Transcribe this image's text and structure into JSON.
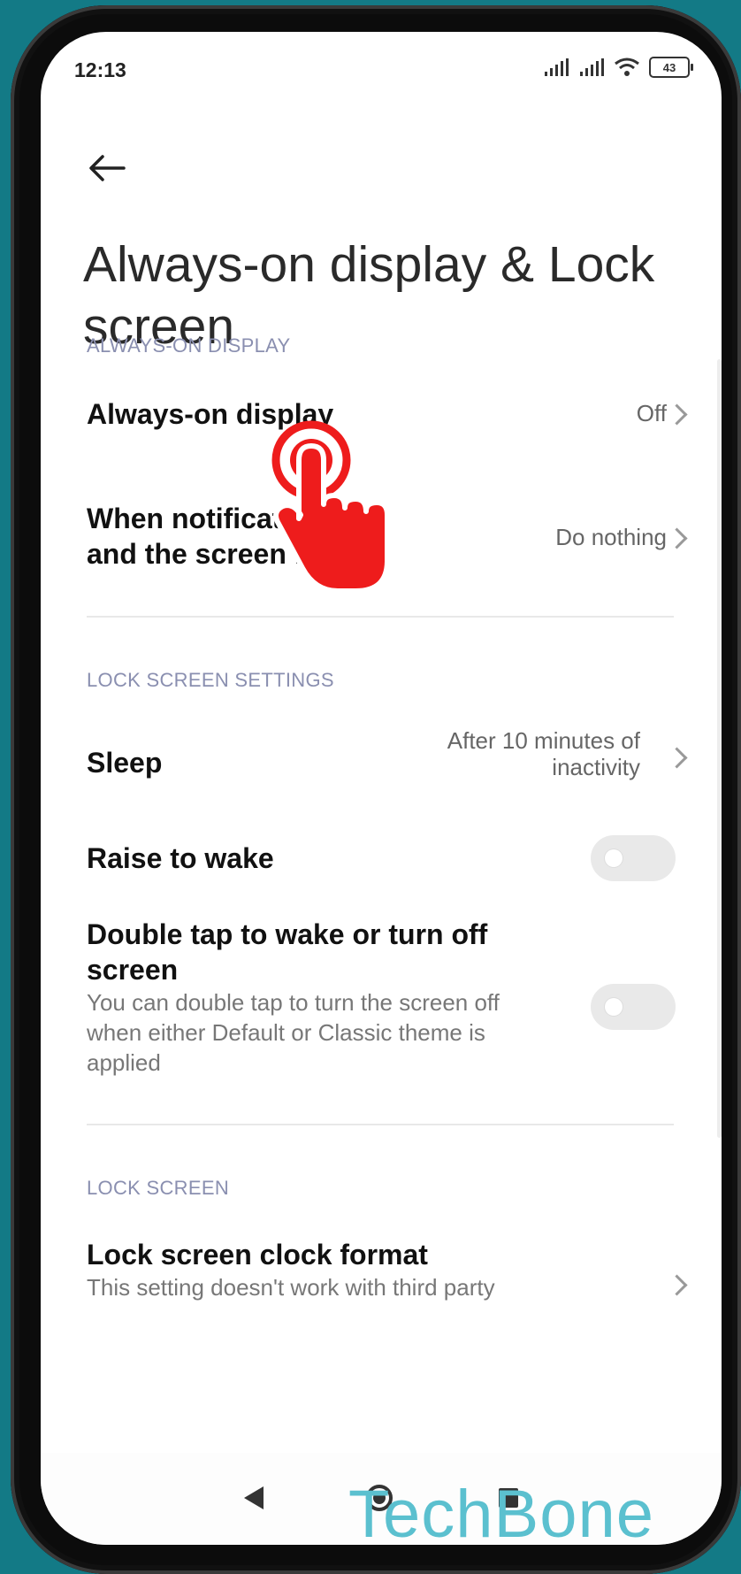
{
  "status_bar": {
    "time": "12:13",
    "battery": "43"
  },
  "header": {
    "title": "Always-on display & Lock screen"
  },
  "sections": {
    "aod": {
      "header": "ALWAYS-ON DISPLAY"
    },
    "lock_settings": {
      "header": "LOCK SCREEN SETTINGS"
    },
    "lock_screen": {
      "header": "LOCK SCREEN"
    }
  },
  "rows": {
    "aod": {
      "title": "Always-on display",
      "value": "Off"
    },
    "notif": {
      "title_line1": "When notification    e",
      "title_line2": "and the screen i",
      "value": "Do nothing"
    },
    "sleep": {
      "title": "Sleep",
      "value_line1": "After 10 minutes of",
      "value_line2": "inactivity"
    },
    "raise": {
      "title": "Raise to wake",
      "enabled": false
    },
    "double_tap": {
      "title_line1": "Double tap to wake or turn off",
      "title_line2": "screen",
      "sub_line1": "You can double tap to turn the screen off",
      "sub_line2": "when either Default or Classic theme is",
      "sub_line3": "applied",
      "enabled": false
    },
    "clock_format": {
      "title": "Lock screen clock format",
      "sub": "This setting doesn't work with third party"
    }
  },
  "watermark": "TechBone",
  "colors": {
    "accent_section": "#8a8fb0",
    "hand": "#ee1c1c",
    "background": "#137a86",
    "watermark": "#5bc0cf"
  },
  "icons": [
    "back-arrow-icon",
    "signal-icon",
    "wifi-icon",
    "battery-icon",
    "chevron-right-icon",
    "tap-hand-icon"
  ]
}
